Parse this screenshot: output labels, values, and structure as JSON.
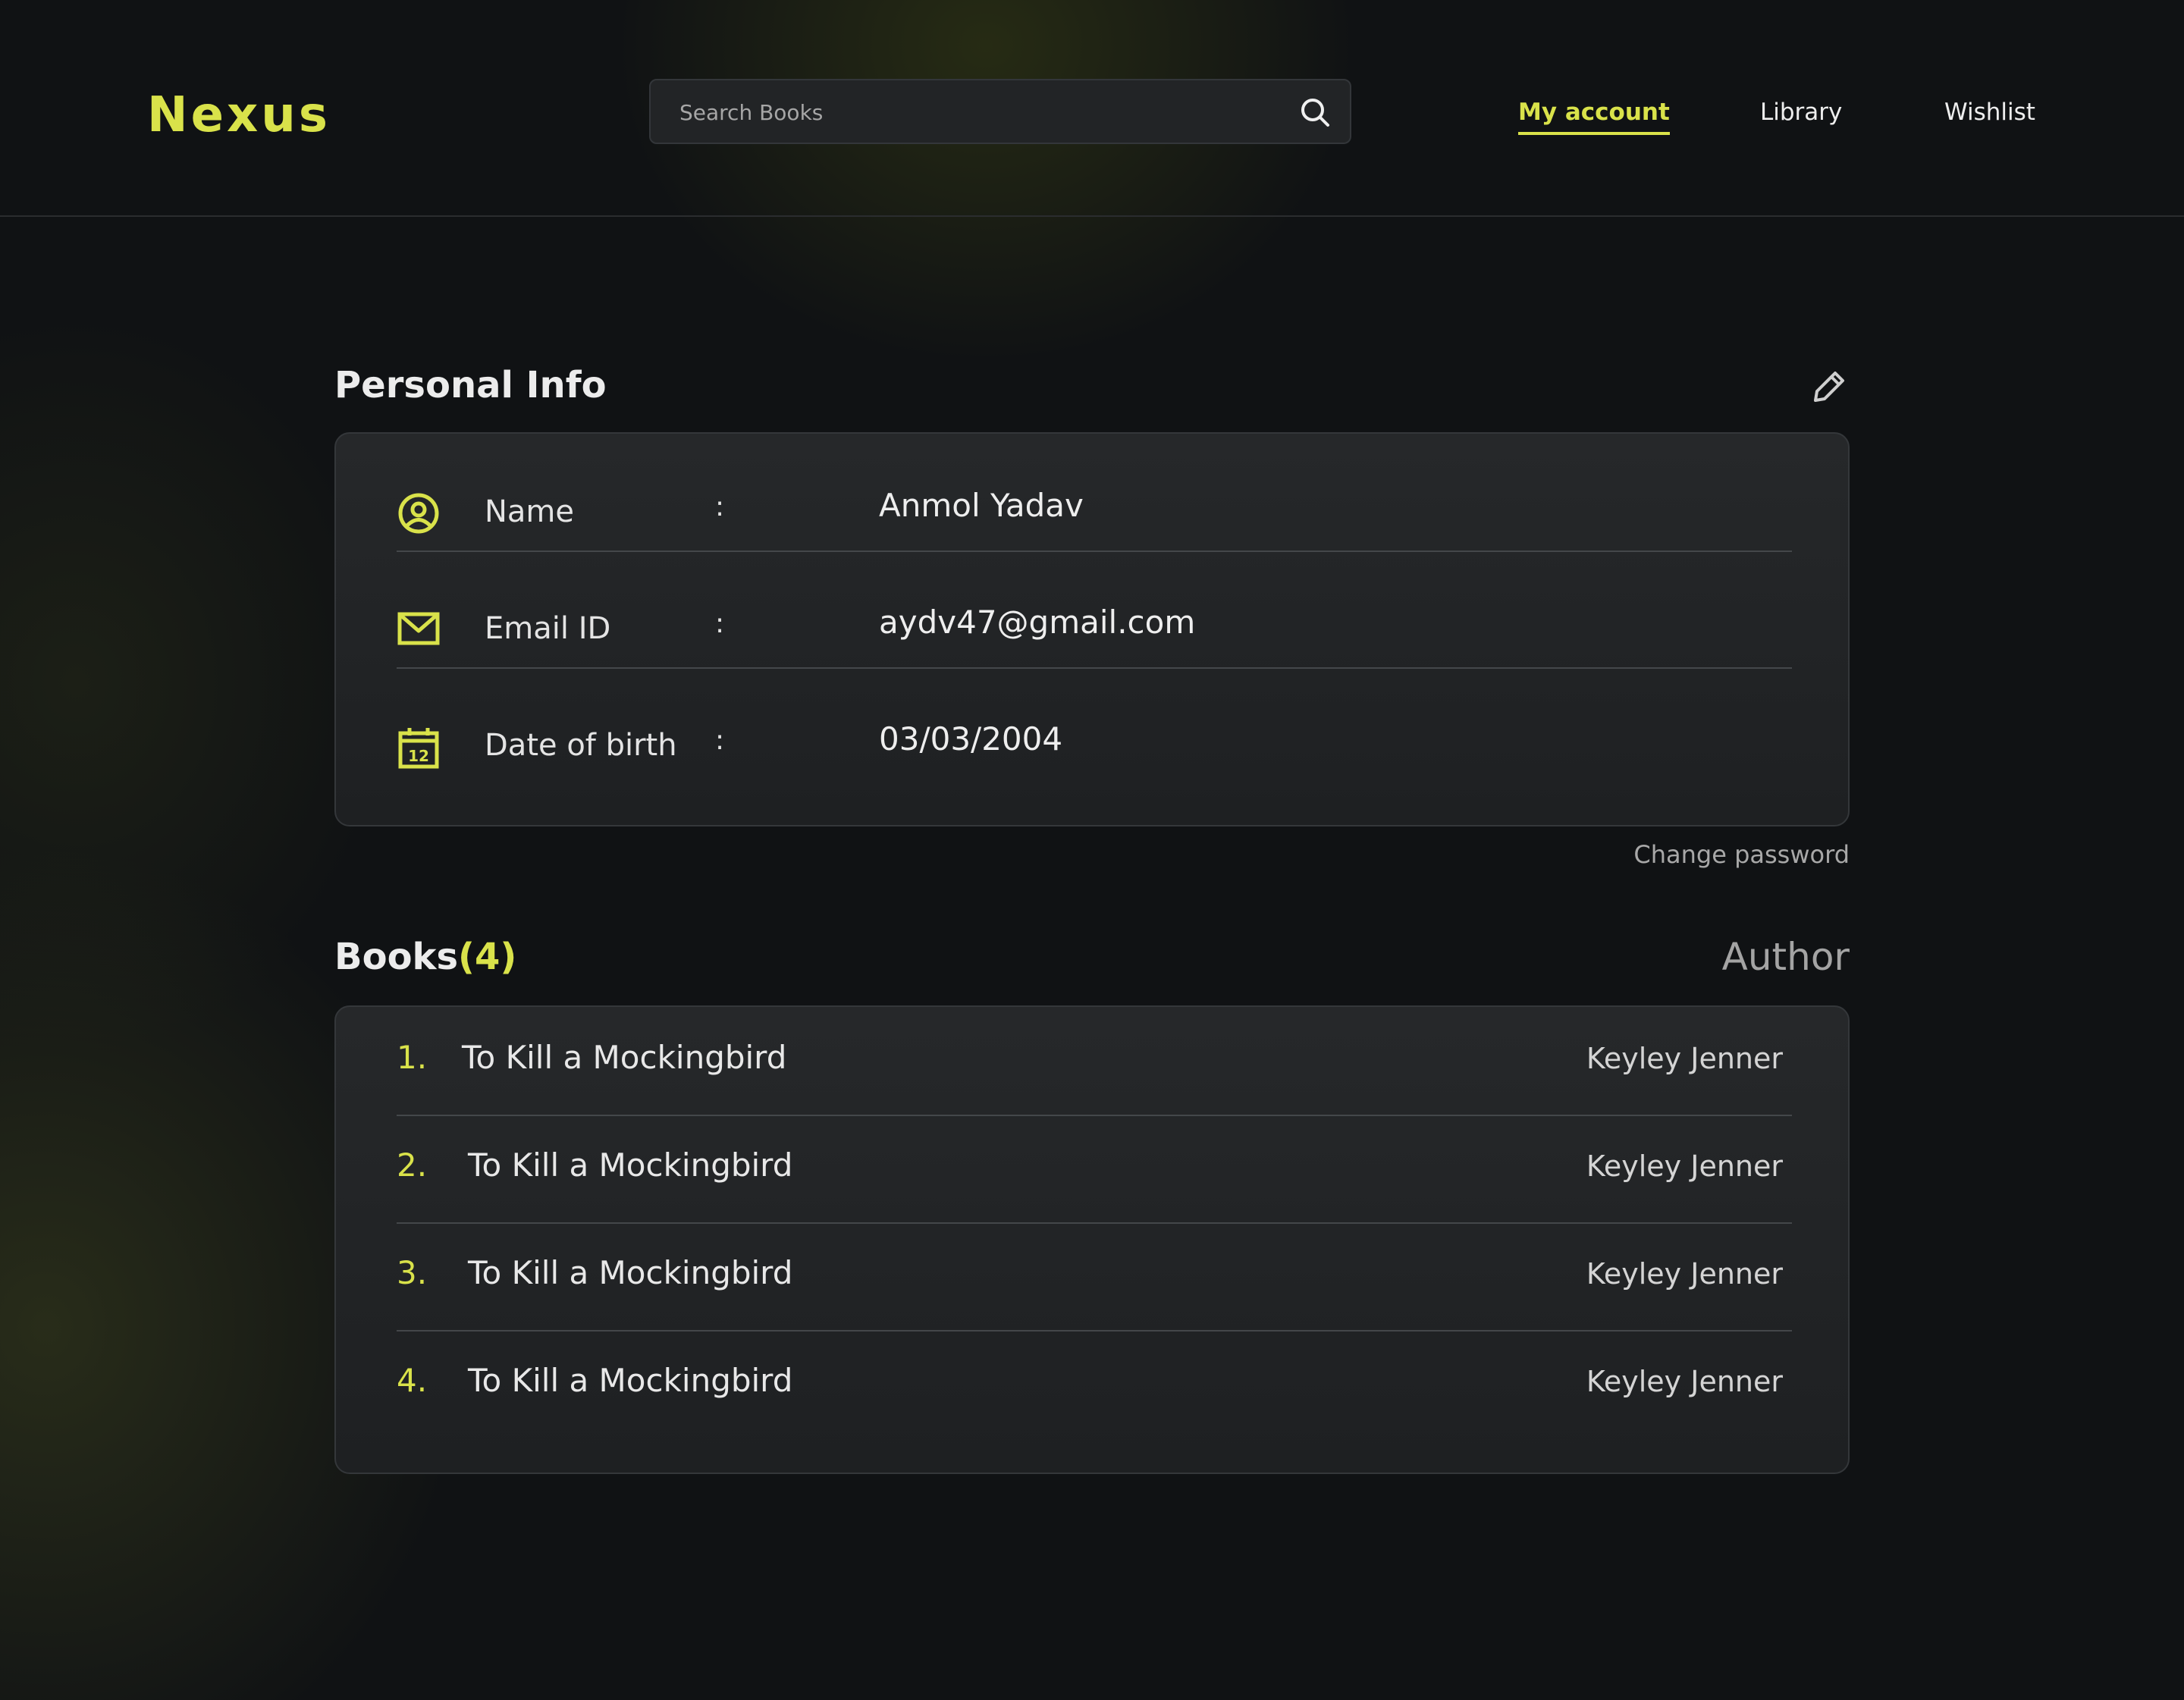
{
  "app": {
    "logo": "Nexus",
    "accent_color": "#d9e24a"
  },
  "search": {
    "placeholder": "Search Books",
    "value": "",
    "icon": "search-icon"
  },
  "nav": {
    "items": [
      {
        "label": "My account",
        "active": true
      },
      {
        "label": "Library",
        "active": false
      },
      {
        "label": "Wishlist",
        "active": false
      }
    ]
  },
  "personal_info": {
    "title": "Personal Info",
    "edit_icon": "pencil-icon",
    "rows": [
      {
        "icon": "user-circle-icon",
        "label": "Name",
        "colon": ":",
        "value": "Anmol Yadav"
      },
      {
        "icon": "mail-icon",
        "label": "Email ID",
        "colon": ":",
        "value": "aydv47@gmail.com"
      },
      {
        "icon": "calendar-icon",
        "label": "Date of birth",
        "colon": ":",
        "value": "03/03/2004"
      }
    ],
    "calendar_day": "12",
    "change_password": "Change password"
  },
  "books": {
    "title": "Books",
    "count": "(4)",
    "author_header": "Author",
    "items": [
      {
        "num": "1.",
        "title": "To Kill a Mockingbird",
        "author": "Keyley Jenner"
      },
      {
        "num": "2.",
        "title": "To Kill a Mockingbird",
        "author": "Keyley Jenner"
      },
      {
        "num": "3.",
        "title": "To Kill a Mockingbird",
        "author": "Keyley Jenner"
      },
      {
        "num": "4.",
        "title": "To Kill a Mockingbird",
        "author": "Keyley Jenner"
      }
    ]
  }
}
